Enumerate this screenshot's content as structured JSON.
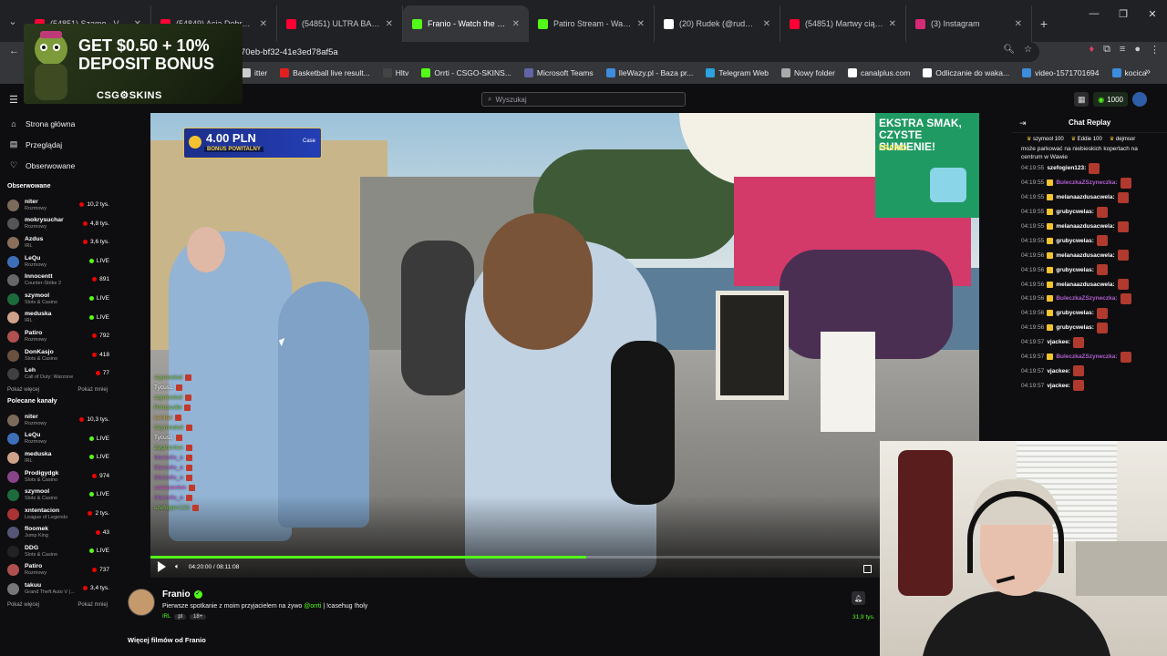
{
  "browser": {
    "tabs": [
      {
        "title": "(54851) Szamo - Vibe Ch",
        "icon_color": "#ff0033",
        "active": false
      },
      {
        "title": "(54849) Asia Dobrowolska",
        "icon_color": "#ff0033",
        "active": false
      },
      {
        "title": "(54851) ULTRA BALTIC",
        "icon_color": "#ff0033",
        "active": false
      },
      {
        "title": "Franio - Watch the VOD o",
        "icon_color": "#53fc18",
        "active": true
      },
      {
        "title": "Patiro Stream - Watch Liv",
        "icon_color": "#53fc18",
        "active": false
      },
      {
        "title": "(20) Rudek (@rudek_k) / X",
        "icon_color": "#ffffff",
        "active": false
      },
      {
        "title": "(54851) Martwy ciąg 100",
        "icon_color": "#ff0033",
        "active": false
      },
      {
        "title": "(3) Instagram",
        "icon_color": "#d62976",
        "active": false
      }
    ],
    "new_tab": "+",
    "url": "70eb-bf32-41e3ed78af5a",
    "bookmarks": [
      {
        "label": "itter",
        "icon_color": "#cccccc"
      },
      {
        "label": "Basketball live result...",
        "icon_color": "#e02020"
      },
      {
        "label": "Hltv",
        "icon_color": "#444444"
      },
      {
        "label": "Orrti - CSGO-SKINS...",
        "icon_color": "#53fc18"
      },
      {
        "label": "Microsoft Teams",
        "icon_color": "#6264a7"
      },
      {
        "label": "IleWazy.pl - Baza pr...",
        "icon_color": "#3c8dde"
      },
      {
        "label": "Telegram Web",
        "icon_color": "#2aa3df"
      },
      {
        "label": "Nowy folder",
        "icon_color": "#aaaaaa"
      },
      {
        "label": "canalplus.com",
        "icon_color": "#ffffff"
      },
      {
        "label": "Odliczanie do waka...",
        "icon_color": "#ffffff"
      },
      {
        "label": "video-1571701694",
        "icon_color": "#3c8dde"
      },
      {
        "label": "kocica",
        "icon_color": "#3c8dde"
      }
    ]
  },
  "ad": {
    "headline": "GET $0.50 + 10% DEPOSIT BONUS",
    "brand": "CSG⚙SKINS"
  },
  "site": {
    "search_placeholder": "Wyszukaj",
    "coins": "1000",
    "accent": "#53fc18"
  },
  "sidebar": {
    "nav": [
      {
        "label": "Strona główna",
        "icon": "home-icon",
        "glyph": "⌂"
      },
      {
        "label": "Przeglądaj",
        "icon": "browse-icon",
        "glyph": "▤"
      },
      {
        "label": "Obserwowane",
        "icon": "heart-icon",
        "glyph": "♡"
      }
    ],
    "followed_title": "Obserwowane",
    "followed": [
      {
        "name": "niter",
        "category": "Rozmowy",
        "viewers": "10,2 tys.",
        "color": "#7b6a5a"
      },
      {
        "name": "mokrysuchar",
        "category": "Rozmowy",
        "viewers": "4,8 tys.",
        "color": "#555555"
      },
      {
        "name": "Azdus",
        "category": "IRL",
        "viewers": "3,6 tys.",
        "color": "#8a6f5a"
      },
      {
        "name": "LeQu",
        "category": "Rozmowy",
        "viewers": "LIVE",
        "color": "#3d6fb8"
      },
      {
        "name": "Innocentt",
        "category": "Counter-Strike 2",
        "viewers": "891",
        "color": "#666666"
      },
      {
        "name": "szymool",
        "category": "Slots & Casino",
        "viewers": "LIVE",
        "color": "#1d6b3c"
      },
      {
        "name": "meduska",
        "category": "IRL",
        "viewers": "LIVE",
        "color": "#cfa28a"
      },
      {
        "name": "Patiro",
        "category": "Rozmowy",
        "viewers": "792",
        "color": "#b05050"
      },
      {
        "name": "DonKasjo",
        "category": "Slots & Casino",
        "viewers": "418",
        "color": "#6a5040"
      },
      {
        "name": "Leh",
        "category": "Call of Duty: Warzone",
        "viewers": "77",
        "color": "#404040"
      }
    ],
    "show_more": "Pokaż więcej",
    "show_less": "Pokaż mniej",
    "recommended_title": "Polecane kanały",
    "recommended": [
      {
        "name": "niter",
        "category": "Rozmowy",
        "viewers": "10,3 tys.",
        "color": "#7b6a5a"
      },
      {
        "name": "LeQu",
        "category": "Rozmowy",
        "viewers": "LIVE",
        "color": "#3d6fb8"
      },
      {
        "name": "meduska",
        "category": "IRL",
        "viewers": "LIVE",
        "color": "#cfa28a"
      },
      {
        "name": "Prodigydgk",
        "category": "Slots & Casino",
        "viewers": "974",
        "color": "#884488"
      },
      {
        "name": "szymool",
        "category": "Slots & Casino",
        "viewers": "LIVE",
        "color": "#1d6b3c"
      },
      {
        "name": "xntentacion",
        "category": "League of Legends",
        "viewers": "2 tys.",
        "color": "#aa3333"
      },
      {
        "name": "floomek",
        "category": "Jump King",
        "viewers": "43",
        "color": "#555577"
      },
      {
        "name": "DDG",
        "category": "Slots & Casino",
        "viewers": "LIVE",
        "color": "#222222"
      },
      {
        "name": "Patiro",
        "category": "Rozmowy",
        "viewers": "737",
        "color": "#b05050"
      },
      {
        "name": "takuu",
        "category": "Grand Theft Auto V (...",
        "viewers": "3,4 tys.",
        "color": "#777777"
      }
    ]
  },
  "video": {
    "promo_amount": "4.00 PLN",
    "promo_label": "BONUS POWITALNY",
    "promo_brand": "Case",
    "ad2_line1": "EKSTRA SMAK, CZYSTE SUMIENIE!",
    "ad2_line2": "FRANIO",
    "overlay_chat": [
      {
        "user": "szymoolxd",
        "color": "#7ac143"
      },
      {
        "user": "Tycus1",
        "color": "#ffffff"
      },
      {
        "user": "szymoolxd",
        "color": "#7ac143"
      },
      {
        "user": "Primacolle",
        "color": "#7ac143"
      },
      {
        "user": "Leonar",
        "color": "#c9a93a"
      },
      {
        "user": "Szymoolxd",
        "color": "#7ac143"
      },
      {
        "user": "Tycus1",
        "color": "#ffffff"
      },
      {
        "user": "Zygmuntsx",
        "color": "#7ac143"
      },
      {
        "user": "Marcello_o",
        "color": "#b05fd0"
      },
      {
        "user": "Marcello_o",
        "color": "#b05fd0"
      },
      {
        "user": "Marcello_o",
        "color": "#b05fd0"
      },
      {
        "user": "szerszenhm",
        "color": "#d24fd0"
      },
      {
        "user": "Marcello_o",
        "color": "#b05fd0"
      },
      {
        "user": "szefogien123",
        "color": "#7ac143"
      }
    ],
    "timecode": "04:20:00 / 08:11:08",
    "progress_fraction": 0.526
  },
  "streamer": {
    "name": "Franio",
    "title_before": "Pierwsze spotkanie z moim przyjacielem na żywo ",
    "title_mention": "@orrti",
    "title_after": " | !casehug !holy",
    "category": "IRL",
    "lang": "pl",
    "age": "18+",
    "views": "31,9 tys.",
    "more_videos": "Więcej filmów od Franio"
  },
  "chat": {
    "title": "Chat Replay",
    "pinned": [
      "szymool 100",
      "Eddie 100",
      "dejmsor"
    ],
    "first_message": "może parkować na niebieskich kopertach na centrum w Wawie",
    "messages": [
      {
        "time": "04:19:55",
        "user": "szefogien123:",
        "color": "#ffffff",
        "sub": false
      },
      {
        "time": "04:19:55",
        "user": "BuleczkaZSzyneczka:",
        "color": "#b05fd0",
        "sub": true
      },
      {
        "time": "04:19:55",
        "user": "melanaazdusacwela:",
        "color": "#ffffff",
        "sub": true
      },
      {
        "time": "04:19:55",
        "user": "grubycwelas:",
        "color": "#ffffff",
        "sub": true
      },
      {
        "time": "04:19:55",
        "user": "melanaazdusacwela:",
        "color": "#ffffff",
        "sub": true
      },
      {
        "time": "04:19:55",
        "user": "grubycwelas:",
        "color": "#ffffff",
        "sub": true
      },
      {
        "time": "04:19:56",
        "user": "melanaazdusacwela:",
        "color": "#ffffff",
        "sub": true
      },
      {
        "time": "04:19:56",
        "user": "grubycwelas:",
        "color": "#ffffff",
        "sub": true
      },
      {
        "time": "04:19:56",
        "user": "melanaazdusacwela:",
        "color": "#ffffff",
        "sub": true
      },
      {
        "time": "04:19:56",
        "user": "BuleczkaZSzyneczka:",
        "color": "#b05fd0",
        "sub": true
      },
      {
        "time": "04:19:56",
        "user": "grubycwelas:",
        "color": "#ffffff",
        "sub": true
      },
      {
        "time": "04:19:56",
        "user": "grubycwelas:",
        "color": "#ffffff",
        "sub": true
      },
      {
        "time": "04:19:57",
        "user": "vjackee:",
        "color": "#ffffff",
        "sub": false
      },
      {
        "time": "04:19:57",
        "user": "BuleczkaZSzyneczka:",
        "color": "#b05fd0",
        "sub": true
      },
      {
        "time": "04:19:57",
        "user": "vjackee:",
        "color": "#ffffff",
        "sub": false
      },
      {
        "time": "04:19:57",
        "user": "vjackee:",
        "color": "#ffffff",
        "sub": false
      }
    ]
  }
}
